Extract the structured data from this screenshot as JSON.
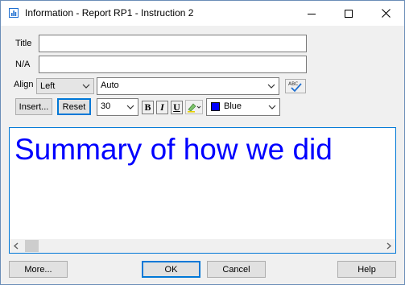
{
  "window": {
    "title": "Information - Report RP1 - Instruction 2",
    "icon": "bar-chart-icon",
    "controls": [
      "minimize-icon",
      "maximize-icon",
      "close-icon"
    ]
  },
  "fields": {
    "title_label": "Title",
    "title_value": "",
    "na_label": "N/A",
    "na_value": "",
    "align_label": "Align"
  },
  "toolbar": {
    "align_value": "Left",
    "auto_value": "Auto",
    "spellcheck_icon": "spellcheck-icon",
    "spellcheck_text": "ABC",
    "insert_label": "Insert...",
    "reset_label": "Reset",
    "font_size": "30",
    "bold": "B",
    "italic": "I",
    "underline": "U",
    "highlight_icon": "highlighter-icon",
    "color_name": "Blue",
    "color_hex": "#0000ff"
  },
  "editor": {
    "text": "Summary of how we did",
    "text_color": "#0000ff"
  },
  "buttons": {
    "more": "More...",
    "ok": "OK",
    "cancel": "Cancel",
    "help": "Help"
  }
}
